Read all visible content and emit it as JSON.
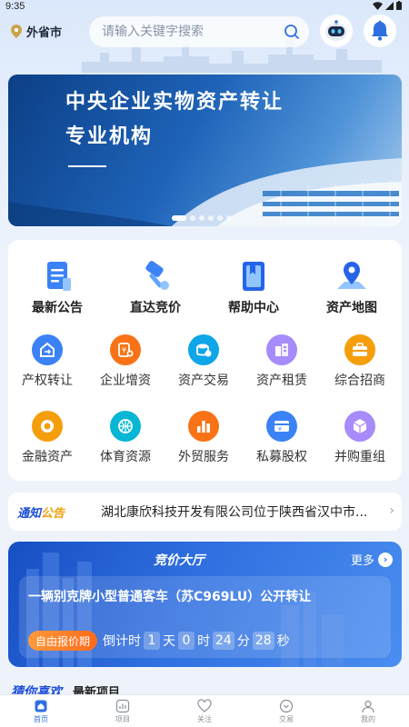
{
  "status_bar": {
    "time": "9:35"
  },
  "header": {
    "location": "外省市",
    "search_placeholder": "请输入关键字搜索"
  },
  "banner": {
    "title_line1": "中央企业实物资产转让",
    "title_line2": "专业机构",
    "dot_count": 6,
    "active_dot": 0
  },
  "quick_menu": [
    {
      "label": "最新公告",
      "icon": "announcement-icon"
    },
    {
      "label": "直达竞价",
      "icon": "auction-hammer-icon"
    },
    {
      "label": "帮助中心",
      "icon": "help-book-icon"
    },
    {
      "label": "资产地图",
      "icon": "map-pin-icon"
    }
  ],
  "services_row1": [
    {
      "label": "产权转让",
      "icon": "transfer-icon",
      "color": "#3b82f6"
    },
    {
      "label": "企业增资",
      "icon": "capital-increase-icon",
      "color": "#f97316"
    },
    {
      "label": "资产交易",
      "icon": "asset-trade-icon",
      "color": "#0ea5e9"
    },
    {
      "label": "资产租赁",
      "icon": "lease-icon",
      "color": "#a78bfa"
    },
    {
      "label": "综合招商",
      "icon": "briefcase-icon",
      "color": "#f59e0b"
    }
  ],
  "services_row2": [
    {
      "label": "金融资产",
      "icon": "coin-icon",
      "color": "#f59e0b"
    },
    {
      "label": "体育资源",
      "icon": "basketball-icon",
      "color": "#06b6d4"
    },
    {
      "label": "外贸服务",
      "icon": "bar-chart-icon",
      "color": "#f97316"
    },
    {
      "label": "私募股权",
      "icon": "equity-card-icon",
      "color": "#3b82f6"
    },
    {
      "label": "并购重组",
      "icon": "cube-icon",
      "color": "#a78bfa"
    }
  ],
  "notice": {
    "badge_part1": "通知",
    "badge_part2": "公告",
    "text": "湖北康欣科技开发有限公司位于陕西省汉中市..."
  },
  "auction": {
    "title": "竞价大厅",
    "more": "更多",
    "item_title": "一辆别克牌小型普通客车（苏C969LU）公开转让",
    "tag": "自由报价期",
    "countdown_label": "倒计时",
    "days": "1",
    "day_unit": "天",
    "hours": "0",
    "hour_unit": "时",
    "minutes": "24",
    "minute_unit": "分",
    "seconds": "28",
    "second_unit": "秒"
  },
  "recommend": {
    "tab_active": "猜你喜欢",
    "tab_other": "最新项目"
  },
  "tabbar": [
    {
      "label": "首页",
      "icon": "home-icon",
      "active": true
    },
    {
      "label": "项目",
      "icon": "project-icon",
      "active": false
    },
    {
      "label": "关注",
      "icon": "heart-icon",
      "active": false
    },
    {
      "label": "交易",
      "icon": "trade-icon",
      "active": false
    },
    {
      "label": "我的",
      "icon": "profile-icon",
      "active": false
    }
  ],
  "colors": {
    "primary": "#2f6fe0",
    "accent_orange": "#ff7a1a"
  }
}
